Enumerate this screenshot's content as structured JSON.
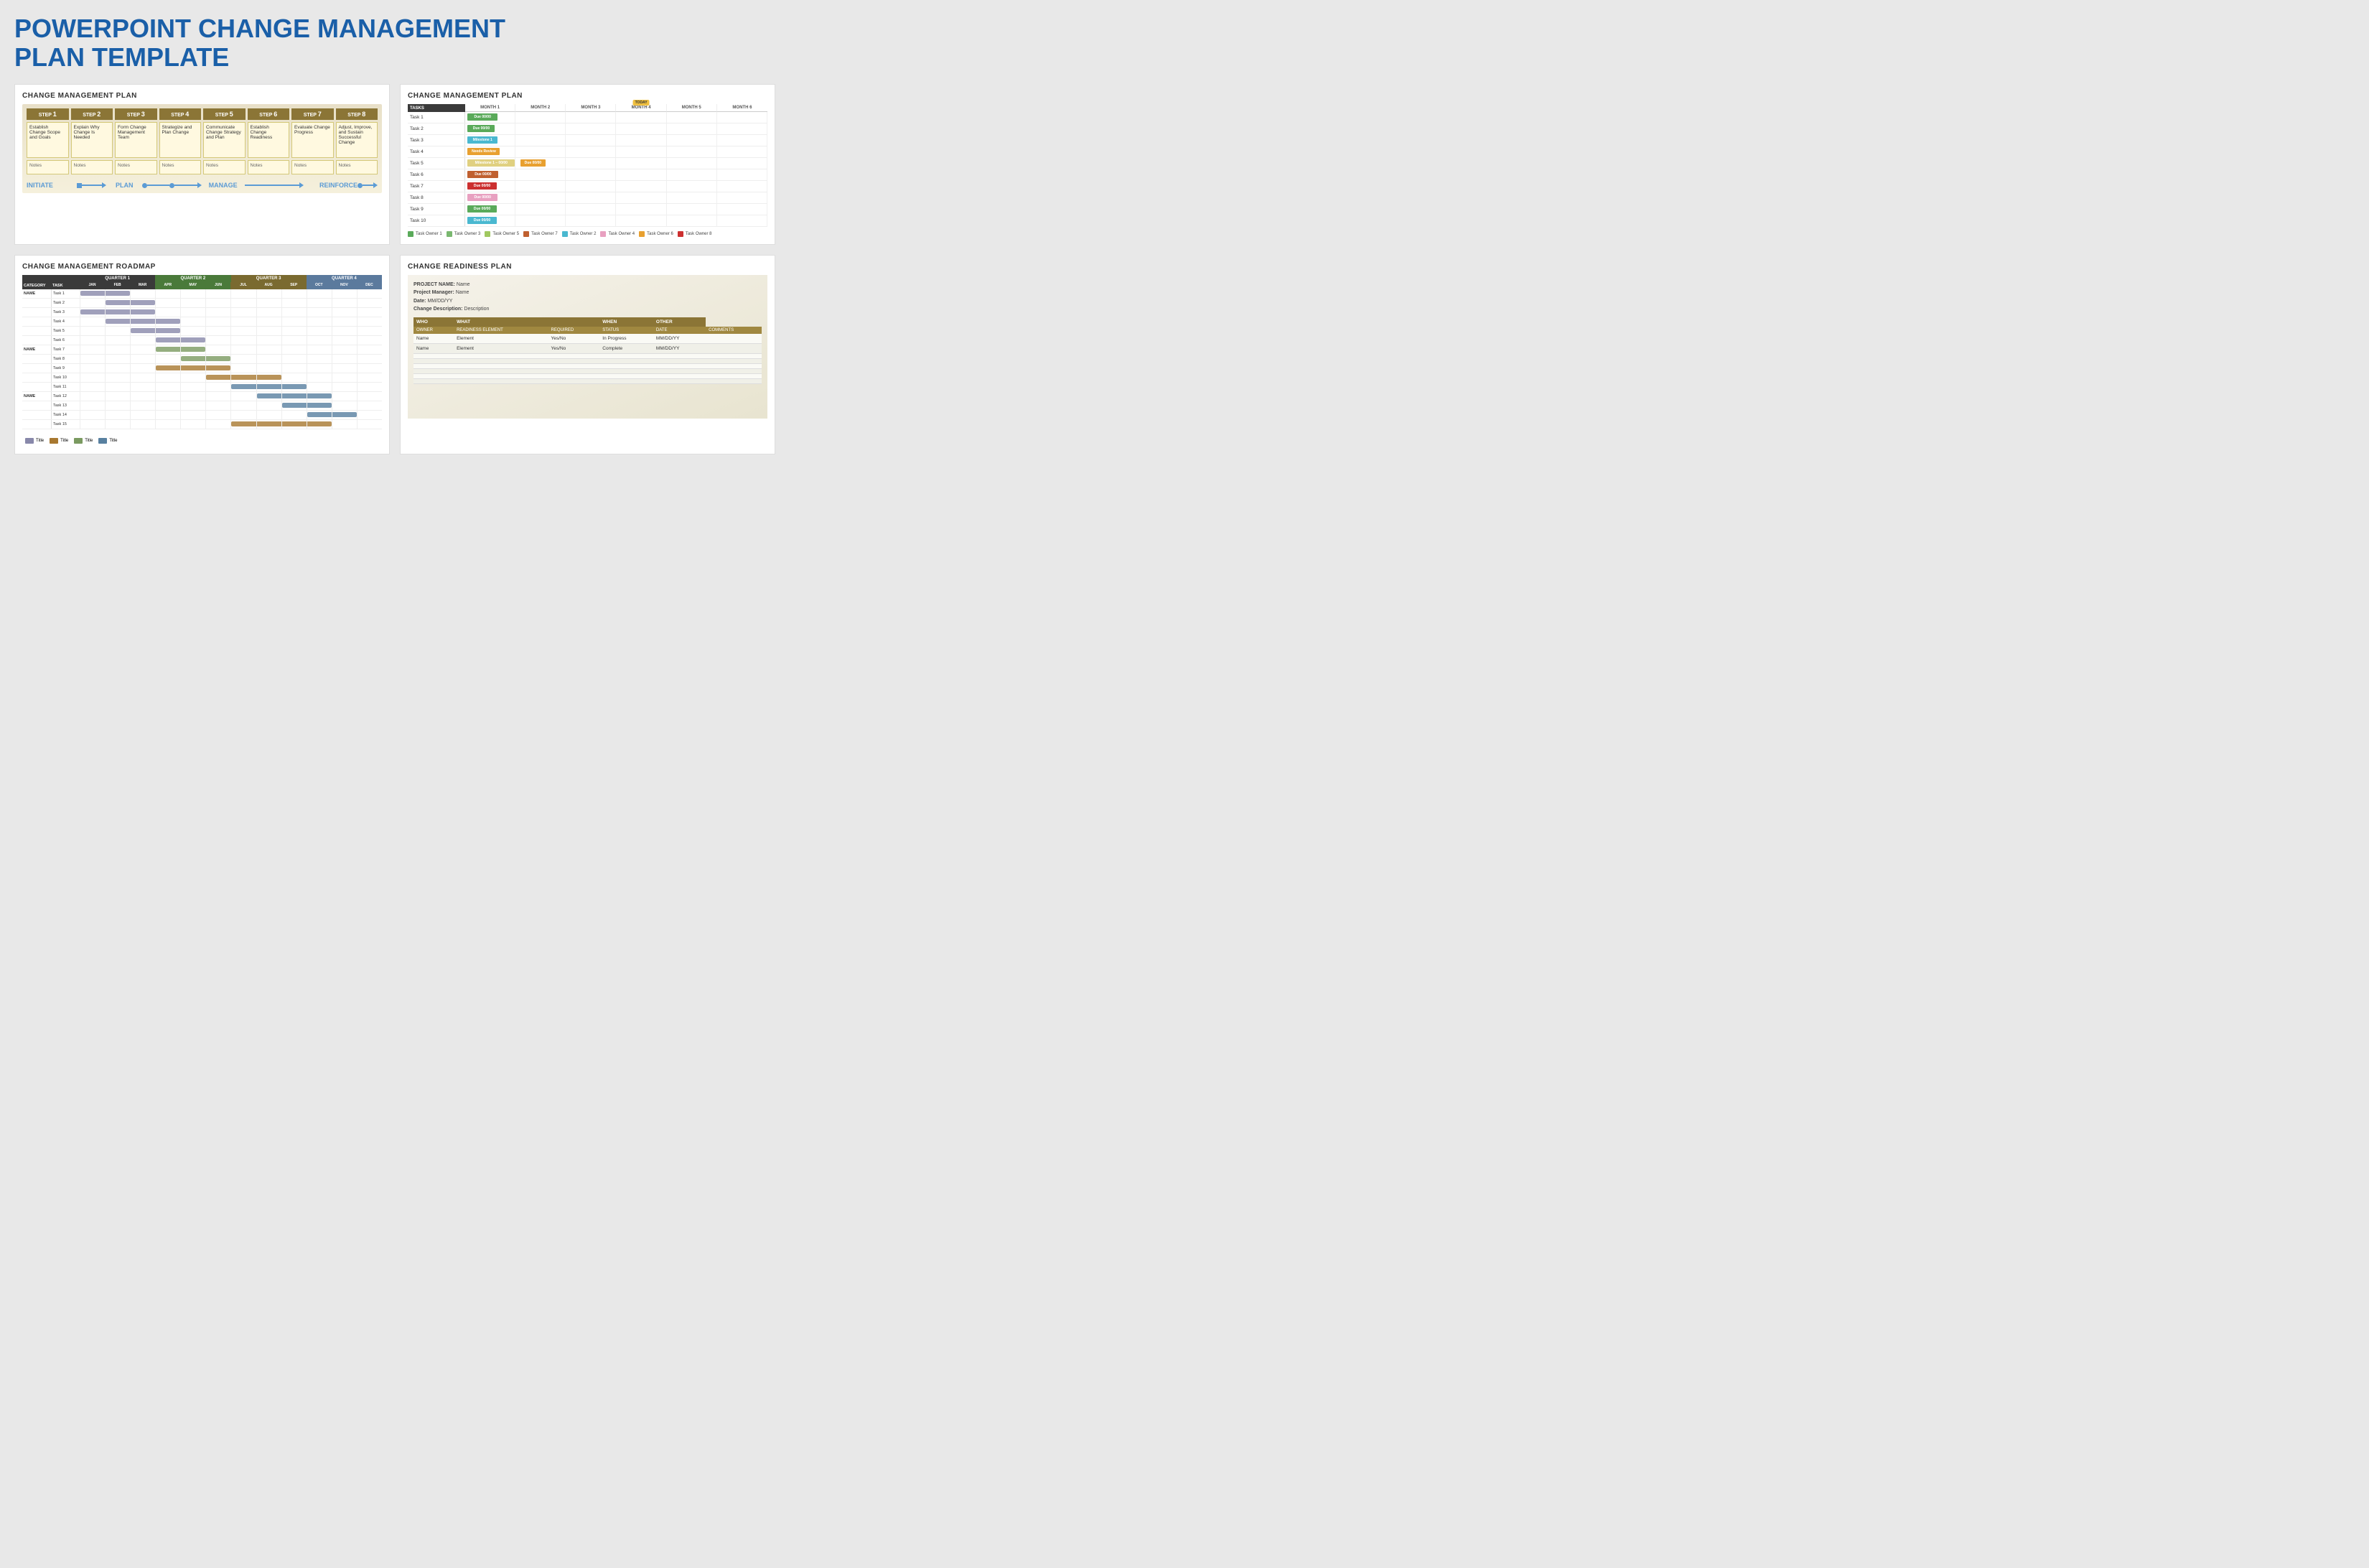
{
  "page": {
    "title_line1": "POWERPOINT CHANGE MANAGEMENT",
    "title_line2": "PLAN TEMPLATE"
  },
  "panel1": {
    "title": "CHANGE MANAGEMENT PLAN",
    "steps": [
      {
        "num": "1",
        "text": "Establish Change Scope and Goals",
        "notes": "Notes"
      },
      {
        "num": "2",
        "text": "Explain Why Change Is Needed",
        "notes": "Notes"
      },
      {
        "num": "3",
        "text": "Form Change Management Team",
        "notes": "Notes"
      },
      {
        "num": "4",
        "text": "Strategize and Plan Change",
        "notes": "Notes"
      },
      {
        "num": "5",
        "text": "Communicate Change Strategy and Plan",
        "notes": "Notes"
      },
      {
        "num": "6",
        "text": "Establish Change Readiness",
        "notes": "Notes"
      },
      {
        "num": "7",
        "text": "Evaluate Change Progress",
        "notes": "Notes"
      },
      {
        "num": "8",
        "text": "Adjust, Improve, and Sustain Successful Change",
        "notes": "Notes"
      }
    ],
    "timeline": [
      {
        "label": "INITIATE",
        "span": 2
      },
      {
        "label": "PLAN",
        "span": 2
      },
      {
        "label": "MANAGE",
        "span": 2
      },
      {
        "label": "REINFORCE",
        "span": 2
      }
    ]
  },
  "panel2": {
    "title": "CHANGE MANAGEMENT PLAN",
    "today_label": "TODAY",
    "months": [
      "MONTH 1",
      "MONTH 2",
      "MONTH 3",
      "MONTH 4",
      "MONTH 5",
      "MONTH 6"
    ],
    "tasks_header": "TASKS",
    "tasks": [
      {
        "name": "Task 1",
        "bar": {
          "col": 1,
          "color": "#5aaa5a",
          "label": "Due 00/00",
          "left": "5%",
          "width": "55%"
        }
      },
      {
        "name": "Task 2",
        "bar": {
          "col": 1,
          "color": "#5aaa5a",
          "label": "Due 00/00",
          "left": "5%",
          "width": "50%"
        }
      },
      {
        "name": "Task 3",
        "bar": {
          "col": 1,
          "color": "#4ab8d0",
          "label": "Milestone 1",
          "left": "5%",
          "width": "55%"
        }
      },
      {
        "name": "Task 4",
        "bar": {
          "col": 1,
          "color": "#e8a030",
          "label": "Needs Review",
          "left": "5%",
          "width": "60%"
        }
      },
      {
        "name": "Task 5",
        "bar": {
          "col": 1,
          "color": "#e8c060",
          "label": "Milestone 1 – 00/00",
          "left": "5%",
          "width": "100%",
          "extra_bar": {
            "col": 2,
            "color": "#e8a030",
            "label": "Due 00/00",
            "left": "5%",
            "width": "60%"
          }
        }
      },
      {
        "name": "Task 6",
        "bar": {
          "col": 1,
          "color": "#c06030",
          "label": "Due 00/00",
          "left": "5%",
          "width": "60%"
        }
      },
      {
        "name": "Task 7",
        "bar": {
          "col": 1,
          "color": "#cc3030",
          "label": "Due 00/00",
          "left": "5%",
          "width": "55%"
        }
      },
      {
        "name": "Task 8",
        "bar": {
          "col": 1,
          "color": "#e8a0c0",
          "label": "Due 00/00",
          "left": "5%",
          "width": "55%"
        }
      },
      {
        "name": "Task 9",
        "bar": {
          "col": 1,
          "color": "#5aaa5a",
          "label": "Due 00/00",
          "left": "5%",
          "width": "55%"
        }
      },
      {
        "name": "Task 10",
        "bar": {
          "col": 1,
          "color": "#4ab8d0",
          "label": "Due 00/00",
          "left": "5%",
          "width": "55%"
        }
      }
    ],
    "legend": [
      {
        "label": "Task Owner 1",
        "color": "#5aaa5a"
      },
      {
        "label": "Task Owner 2",
        "color": "#4ab8d0"
      },
      {
        "label": "Task Owner 3",
        "color": "#7ab870"
      },
      {
        "label": "Task Owner 4",
        "color": "#e8a0c0"
      },
      {
        "label": "Task Owner 5",
        "color": "#a0c860"
      },
      {
        "label": "Task Owner 6",
        "color": "#e8a030"
      },
      {
        "label": "Task Owner 7",
        "color": "#c06030"
      },
      {
        "label": "Task Owner 8",
        "color": "#cc3030"
      }
    ]
  },
  "panel3": {
    "title": "CHANGE MANAGEMENT ROADMAP",
    "quarters": [
      {
        "label": "QUARTER 1",
        "months": [
          "JAN",
          "FEB",
          "MAR"
        ]
      },
      {
        "label": "QUARTER 2",
        "months": [
          "APR",
          "MAY",
          "JUN"
        ]
      },
      {
        "label": "QUARTER 3",
        "months": [
          "JUL",
          "AUG",
          "SEP"
        ]
      },
      {
        "label": "QUARTER 4",
        "months": [
          "OCT",
          "NOV",
          "DEC"
        ]
      }
    ],
    "categories": [
      {
        "name": "NAME",
        "tasks": [
          {
            "name": "Task 1",
            "bars": [
              {
                "start": 0,
                "span": 2,
                "color": "#8888aa"
              }
            ]
          },
          {
            "name": "Task 2",
            "bars": [
              {
                "start": 1,
                "span": 2,
                "color": "#8888aa"
              }
            ]
          },
          {
            "name": "Task 3",
            "bars": [
              {
                "start": 0,
                "span": 3,
                "color": "#8888aa"
              }
            ]
          },
          {
            "name": "Task 4",
            "bars": [
              {
                "start": 1,
                "span": 3,
                "color": "#8888aa"
              }
            ]
          },
          {
            "name": "Task 5",
            "bars": [
              {
                "start": 2,
                "span": 2,
                "color": "#8888aa"
              }
            ]
          },
          {
            "name": "Task 6",
            "bars": [
              {
                "start": 3,
                "span": 2,
                "color": "#8888aa"
              }
            ]
          }
        ]
      },
      {
        "name": "NAME",
        "tasks": [
          {
            "name": "Task 7",
            "bars": [
              {
                "start": 3,
                "span": 2,
                "color": "#7a9a60"
              }
            ]
          },
          {
            "name": "Task 8",
            "bars": [
              {
                "start": 4,
                "span": 2,
                "color": "#7a9a60"
              }
            ]
          },
          {
            "name": "Task 9",
            "bars": [
              {
                "start": 3,
                "span": 3,
                "color": "#a87830"
              }
            ]
          },
          {
            "name": "Task 10",
            "bars": [
              {
                "start": 5,
                "span": 3,
                "color": "#a87830"
              }
            ]
          },
          {
            "name": "Task 11",
            "bars": [
              {
                "start": 6,
                "span": 3,
                "color": "#5880a0"
              }
            ]
          }
        ]
      },
      {
        "name": "NAME",
        "tasks": [
          {
            "name": "Task 12",
            "bars": [
              {
                "start": 7,
                "span": 3,
                "color": "#5880a0"
              }
            ]
          },
          {
            "name": "Task 13",
            "bars": [
              {
                "start": 8,
                "span": 2,
                "color": "#5880a0"
              }
            ]
          },
          {
            "name": "Task 14",
            "bars": [
              {
                "start": 9,
                "span": 2,
                "color": "#5880a0"
              }
            ]
          },
          {
            "name": "Task 15",
            "bars": [
              {
                "start": 6,
                "span": 4,
                "color": "#a87830"
              }
            ]
          }
        ]
      }
    ],
    "legend": [
      {
        "label": "Title",
        "color": "#8888aa"
      },
      {
        "label": "Title",
        "color": "#7a9a60"
      },
      {
        "label": "Title",
        "color": "#a87830"
      },
      {
        "label": "Title",
        "color": "#5880a0"
      }
    ]
  },
  "panel4": {
    "title": "CHANGE READINESS PLAN",
    "meta": {
      "project_name_label": "PROJECT NAME:",
      "project_name_value": "Name",
      "project_manager_label": "Project Manager:",
      "project_manager_value": "Name",
      "date_label": "Date:",
      "date_value": "MM/DD/YY",
      "change_desc_label": "Change Description:",
      "change_desc_value": "Description"
    },
    "col_headers": [
      {
        "label": "WHO",
        "span": 1
      },
      {
        "label": "WHAT",
        "span": 2
      },
      {
        "label": "WHEN",
        "span": 1
      },
      {
        "label": "OTHER",
        "span": 1
      }
    ],
    "sub_headers": [
      "OWNER",
      "READINESS ELEMENT",
      "REQUIRED",
      "STATUS",
      "DATE",
      "COMMENTS"
    ],
    "rows": [
      {
        "owner": "Name",
        "element": "Element",
        "required": "Yes/No",
        "status": "In Progress",
        "date": "MM/DD/YY",
        "comments": ""
      },
      {
        "owner": "Name",
        "element": "Element",
        "required": "Yes/No",
        "status": "Complete",
        "date": "MM/DD/YY",
        "comments": ""
      },
      {
        "owner": "",
        "element": "",
        "required": "",
        "status": "",
        "date": "",
        "comments": ""
      },
      {
        "owner": "",
        "element": "",
        "required": "",
        "status": "",
        "date": "",
        "comments": ""
      },
      {
        "owner": "",
        "element": "",
        "required": "",
        "status": "",
        "date": "",
        "comments": ""
      },
      {
        "owner": "",
        "element": "",
        "required": "",
        "status": "",
        "date": "",
        "comments": ""
      },
      {
        "owner": "",
        "element": "",
        "required": "",
        "status": "",
        "date": "",
        "comments": ""
      },
      {
        "owner": "",
        "element": "",
        "required": "",
        "status": "",
        "date": "",
        "comments": ""
      }
    ]
  }
}
